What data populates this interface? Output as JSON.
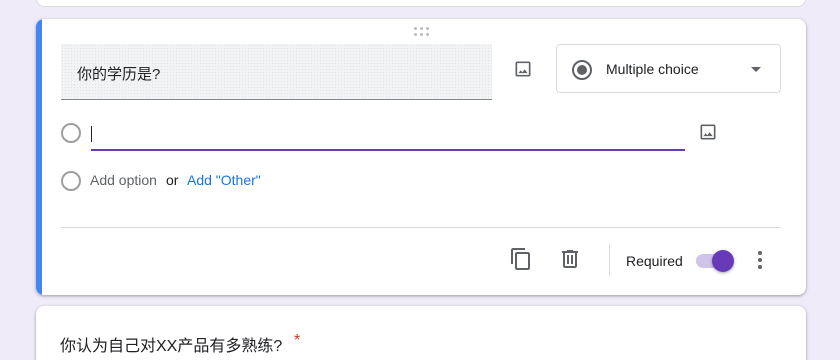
{
  "question": {
    "title": "你的学历是?",
    "type_label": "Multiple choice",
    "option_value": "",
    "add_option_label": "Add option",
    "or_label": "or",
    "add_other_label": "Add \"Other\"",
    "required_label": "Required",
    "required": true
  },
  "next_question": {
    "title": "你认为自己对XX产品有多熟练?",
    "required_marker": "*"
  },
  "icons": {
    "drag": "drag-handle-icon",
    "image": "image-icon",
    "radio": "radio-button-checked-icon",
    "dropdown": "arrow-drop-down-icon",
    "copy": "content-copy-icon",
    "delete": "delete-icon",
    "more": "more-vert-icon"
  },
  "colors": {
    "background": "#f0ebf8",
    "accent": "#4285f4",
    "primary": "#673ab7",
    "link": "#1a73e8",
    "required_star": "#d93025"
  }
}
